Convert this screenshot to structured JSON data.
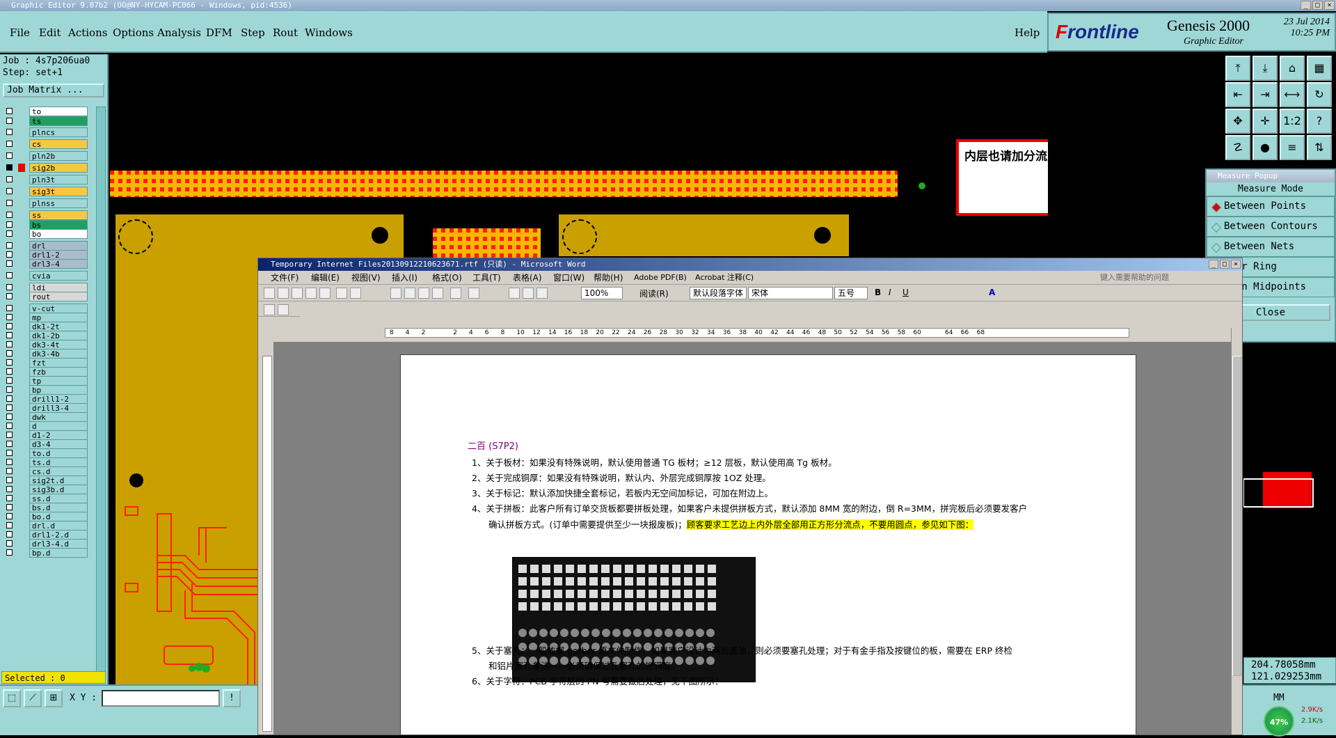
{
  "titlebar": {
    "text": "Graphic Editor 9.07b2 (OO@NY-HYCAM-PC066 - Windows, pid:4536)"
  },
  "menu": {
    "items": [
      "File",
      "Edit",
      "Actions",
      "Options",
      "Analysis",
      "DFM",
      "Step",
      "Rout",
      "Windows"
    ],
    "help": "Help"
  },
  "logo": {
    "brand": "Frontline",
    "product": "Genesis 2000",
    "subtitle": "Graphic Editor",
    "date": "23 Jul 2014",
    "time": "10:25 PM"
  },
  "job": {
    "job_line": "Job : 4s7p206ua0",
    "step_line": "Step: set+1",
    "matrix_button": "Job Matrix ..."
  },
  "layers": [
    {
      "name": "to",
      "color": "#ffffff"
    },
    {
      "name": "ts",
      "color": "#20a060"
    },
    {
      "name": "plncs",
      "color": "#9fd7d7"
    },
    {
      "name": "cs",
      "color": "#f5c842"
    },
    {
      "name": "pln2b",
      "color": "#9fd7d7"
    },
    {
      "name": "sig2b",
      "color": "#f5c842",
      "active": true
    },
    {
      "name": "pln3t",
      "color": "#9fd7d7"
    },
    {
      "name": "sig3t",
      "color": "#f5c842"
    },
    {
      "name": "plnss",
      "color": "#9fd7d7"
    },
    {
      "name": "ss",
      "color": "#f5c842"
    },
    {
      "name": "bs",
      "color": "#20a060"
    },
    {
      "name": "bo",
      "color": "#ffffff"
    },
    {
      "name": "drl",
      "color": "#a8bccb"
    },
    {
      "name": "drl1-2",
      "color": "#a8bccb"
    },
    {
      "name": "drl3-4",
      "color": "#a8bccb"
    },
    {
      "name": "cvia",
      "color": "#9fd7d7"
    },
    {
      "name": "ldi",
      "color": "#d8d8d8"
    },
    {
      "name": "rout",
      "color": "#d8d8d8"
    },
    {
      "name": "v-cut",
      "color": "#9fd7d7"
    },
    {
      "name": "mp",
      "color": "#9fd7d7"
    },
    {
      "name": "dk1-2t",
      "color": "#9fd7d7"
    },
    {
      "name": "dk1-2b",
      "color": "#9fd7d7"
    },
    {
      "name": "dk3-4t",
      "color": "#9fd7d7"
    },
    {
      "name": "dk3-4b",
      "color": "#9fd7d7"
    },
    {
      "name": "fzt",
      "color": "#9fd7d7"
    },
    {
      "name": "fzb",
      "color": "#9fd7d7"
    },
    {
      "name": "tp",
      "color": "#9fd7d7"
    },
    {
      "name": "bp",
      "color": "#9fd7d7"
    },
    {
      "name": "drill1-2",
      "color": "#9fd7d7"
    },
    {
      "name": "drill3-4",
      "color": "#9fd7d7"
    },
    {
      "name": "dwk",
      "color": "#9fd7d7"
    },
    {
      "name": "d",
      "color": "#9fd7d7"
    },
    {
      "name": "d1-2",
      "color": "#9fd7d7"
    },
    {
      "name": "d3-4",
      "color": "#9fd7d7"
    },
    {
      "name": "to.d",
      "color": "#9fd7d7"
    },
    {
      "name": "ts.d",
      "color": "#9fd7d7"
    },
    {
      "name": "cs.d",
      "color": "#9fd7d7"
    },
    {
      "name": "sig2t.d",
      "color": "#9fd7d7"
    },
    {
      "name": "sig3b.d",
      "color": "#9fd7d7"
    },
    {
      "name": "ss.d",
      "color": "#9fd7d7"
    },
    {
      "name": "bs.d",
      "color": "#9fd7d7"
    },
    {
      "name": "bo.d",
      "color": "#9fd7d7"
    },
    {
      "name": "drl.d",
      "color": "#9fd7d7"
    },
    {
      "name": "drl1-2.d",
      "color": "#9fd7d7"
    },
    {
      "name": "drl3-4.d",
      "color": "#9fd7d7"
    },
    {
      "name": "bp.d",
      "color": "#9fd7d7"
    }
  ],
  "selected": "Selected : 0",
  "note": {
    "text": "内层也请加分流点！"
  },
  "measure": {
    "title": "Measure Popup",
    "mode_header": "Measure Mode",
    "options": [
      "Between Points",
      "Between Contours",
      "Between Nets",
      "ular Ring",
      "ween Midpoints"
    ],
    "selected_index": 0,
    "close": "Close"
  },
  "coords": {
    "x": "204.78058mm",
    "y": "121.029253mm"
  },
  "units": "MM",
  "bottom": {
    "xy_label": "X Y :"
  },
  "tray": {
    "percent": "47%",
    "up": "2.9K/s",
    "down": "2.1K/s"
  },
  "word": {
    "title": "Temporary Internet Files20130912210623671.rtf (只读) - Microsoft Word",
    "menu": [
      "文件(F)",
      "编辑(E)",
      "视图(V)",
      "插入(I)",
      "格式(O)",
      "工具(T)",
      "表格(A)",
      "窗口(W)",
      "帮助(H)",
      "Adobe PDF(B)",
      "Acrobat 注释(C)"
    ],
    "help_placeholder": "键入需要帮助的问题",
    "zoom": "100%",
    "read_label": "阅读(R)",
    "style": "默认段落字体",
    "font": "宋体",
    "size": "五号",
    "ruler_ticks": [
      "8",
      "4",
      "2",
      "",
      "2",
      "4",
      "6",
      "8",
      "10",
      "12",
      "14",
      "16",
      "18",
      "20",
      "22",
      "24",
      "26",
      "28",
      "30",
      "32",
      "34",
      "36",
      "38",
      "40",
      "42",
      "44",
      "46",
      "48",
      "50",
      "52",
      "54",
      "56",
      "58",
      "60",
      "",
      "64",
      "66",
      "68"
    ],
    "doc": {
      "heading": "二百 (S7P2)",
      "items": [
        "1、关于板材：如果没有特殊说明，默认使用普通 TG 板材；≥12 层板，默认使用高 Tg 板材。",
        "2、关于完成铜厚：如果没有特殊说明，默认内、外层完成铜厚按 1OZ 处理。",
        "3、关于标记：默认添加快捷全套标记，若板内无空间加标记，可加在附边上。",
        "4、关于拼板：此客户所有订单交货板都要拼板处理，如果客户未提供拼板方式，默认添加 8MM 宽的附边，倒 R=3MM，拼完板后必须要发客户"
      ],
      "item4_cont": "确认拼板方式。(订单中需要提供至少一块报废板)；",
      "item4_highlight": "顾客要求工艺边上内外层全部用正方形分流点，不要用圆点，参见如下图：",
      "item5": "5、关于塞孔：一般依据 gerber 原文件制作，如果客户设计为两面盖油，则必须要塞孔处理；对于有金手指及按键位的板，需要在 ERP 终检",
      "item5_cont": "和铝片塞孔备注——必须确保过孔塞孔的饱满度。",
      "item6": "6、关于字符：PCB 字符层的 PN 号需要做后处理，见下图所示："
    }
  }
}
